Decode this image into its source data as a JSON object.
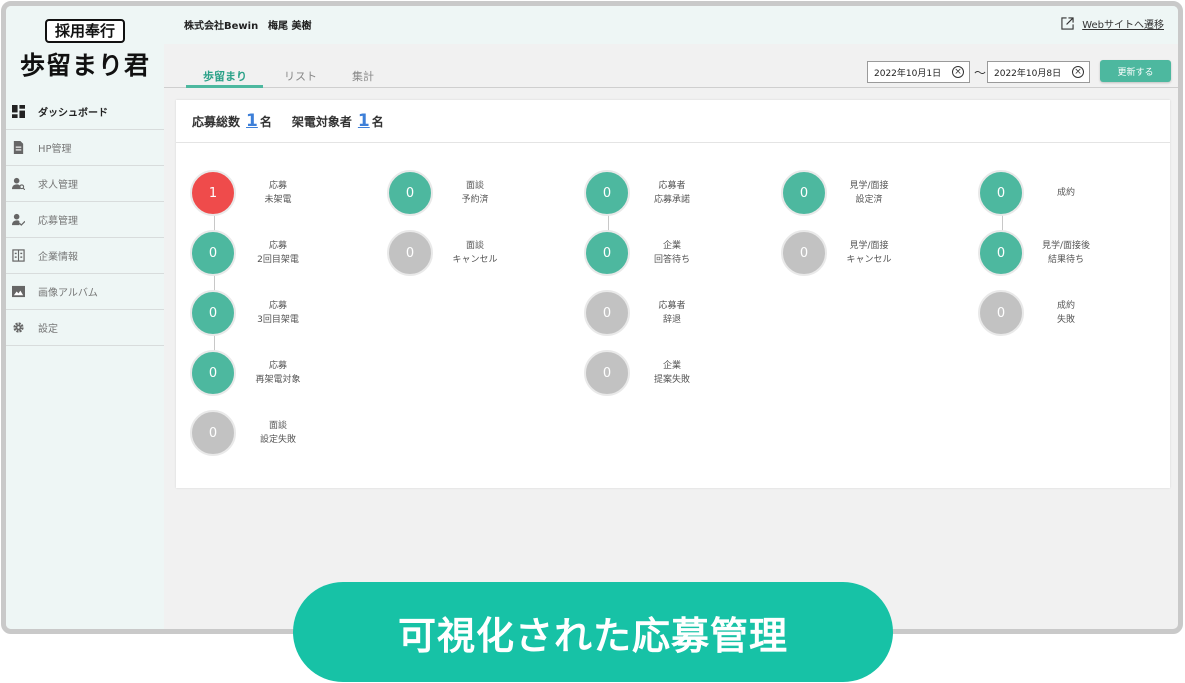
{
  "brand": {
    "logo_top": "採用奉行",
    "logo_main": "歩留まり君"
  },
  "header": {
    "company": "株式会社Bewin",
    "user": "梅尾 美樹",
    "website_link": "Webサイトへ遷移"
  },
  "sidebar": {
    "items": [
      {
        "label": "ダッシュボード",
        "icon": "dashboard-icon"
      },
      {
        "label": "HP管理",
        "icon": "document-icon"
      },
      {
        "label": "求人管理",
        "icon": "user-search-icon"
      },
      {
        "label": "応募管理",
        "icon": "user-check-icon"
      },
      {
        "label": "企業情報",
        "icon": "building-icon"
      },
      {
        "label": "画像アルバム",
        "icon": "image-icon"
      },
      {
        "label": "設定",
        "icon": "gear-icon"
      }
    ]
  },
  "tabs": [
    {
      "label": "歩留まり"
    },
    {
      "label": "リスト"
    },
    {
      "label": "集計"
    }
  ],
  "filter": {
    "date_from": "2022年10月1日",
    "date_to": "2022年10月8日",
    "separator": "～",
    "update_label": "更新する"
  },
  "summary": {
    "applicants_label": "応募総数",
    "applicants_count": "1",
    "applicants_unit": "名",
    "calls_label": "架電対象者",
    "calls_count": "1",
    "calls_unit": "名"
  },
  "stages": [
    {
      "count": "1",
      "line1": "応募",
      "line2": "未架電",
      "status": "red"
    },
    {
      "count": "0",
      "line1": "応募",
      "line2": "2回目架電",
      "status": "green"
    },
    {
      "count": "0",
      "line1": "応募",
      "line2": "3回目架電",
      "status": "green"
    },
    {
      "count": "0",
      "line1": "応募",
      "line2": "再架電対象",
      "status": "green"
    },
    {
      "count": "0",
      "line1": "面談",
      "line2": "設定失敗",
      "status": "gray"
    },
    {
      "count": "0",
      "line1": "面談",
      "line2": "予約済",
      "status": "green"
    },
    {
      "count": "0",
      "line1": "面談",
      "line2": "キャンセル",
      "status": "gray"
    },
    {
      "count": "0",
      "line1": "応募者",
      "line2": "応募承諾",
      "status": "green"
    },
    {
      "count": "0",
      "line1": "企業",
      "line2": "回答待ち",
      "status": "green"
    },
    {
      "count": "0",
      "line1": "応募者",
      "line2": "辞退",
      "status": "gray"
    },
    {
      "count": "0",
      "line1": "企業",
      "line2": "提案失敗",
      "status": "gray"
    },
    {
      "count": "0",
      "line1": "見学/面接",
      "line2": "設定済",
      "status": "green"
    },
    {
      "count": "0",
      "line1": "見学/面接",
      "line2": "キャンセル",
      "status": "gray"
    },
    {
      "count": "0",
      "line1": "成約",
      "line2": "",
      "status": "green"
    },
    {
      "count": "0",
      "line1": "見学/面接後",
      "line2": "結果待ち",
      "status": "green"
    },
    {
      "count": "0",
      "line1": "成約",
      "line2": "失敗",
      "status": "gray"
    }
  ],
  "caption": "可視化された応募管理",
  "colors": {
    "accent": "#4db89f",
    "alert": "#ef4b4b",
    "inactive": "#c2c2c2",
    "caption_bg": "#17c2a6"
  }
}
